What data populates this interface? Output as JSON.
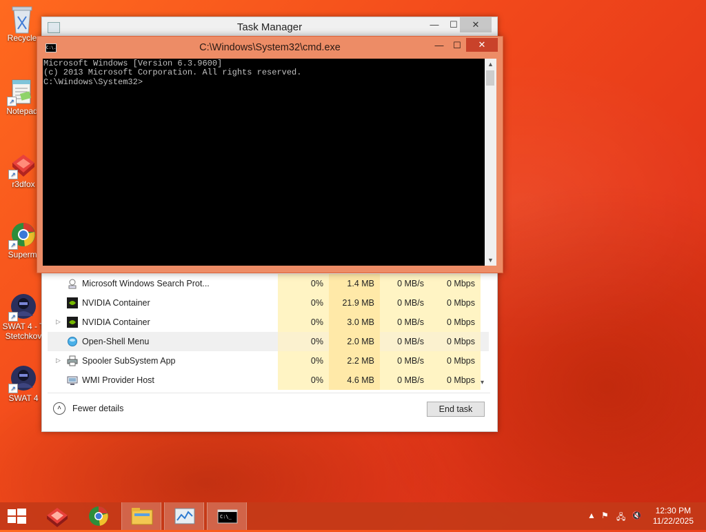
{
  "desktop": {
    "icons": [
      {
        "label": "Recycle",
        "icon": "recycle-bin-icon"
      },
      {
        "label": "Notepad",
        "icon": "notepad-icon"
      },
      {
        "label": "r3dfox",
        "icon": "r3dfox-icon"
      },
      {
        "label": "Supermi",
        "icon": "supermium-icon"
      },
      {
        "label": "SWAT 4 - T",
        "label2": "Stetchkov",
        "icon": "swat4-icon"
      },
      {
        "label": "SWAT 4",
        "icon": "swat4-icon"
      }
    ]
  },
  "task_manager": {
    "title": "Task Manager",
    "rows": [
      {
        "name": "Microsoft Windows Search Prot...",
        "cpu": "0%",
        "memory": "1.4 MB",
        "disk": "0 MB/s",
        "network": "0 Mbps",
        "expandable": false,
        "icon": "search-protocol-icon"
      },
      {
        "name": "NVIDIA Container",
        "cpu": "0%",
        "memory": "21.9 MB",
        "disk": "0 MB/s",
        "network": "0 Mbps",
        "expandable": false,
        "icon": "nvidia-icon"
      },
      {
        "name": "NVIDIA Container",
        "cpu": "0%",
        "memory": "3.0 MB",
        "disk": "0 MB/s",
        "network": "0 Mbps",
        "expandable": true,
        "icon": "nvidia-icon"
      },
      {
        "name": "Open-Shell Menu",
        "cpu": "0%",
        "memory": "2.0 MB",
        "disk": "0 MB/s",
        "network": "0 Mbps",
        "expandable": false,
        "icon": "open-shell-icon",
        "selected": true
      },
      {
        "name": "Spooler SubSystem App",
        "cpu": "0%",
        "memory": "2.2 MB",
        "disk": "0 MB/s",
        "network": "0 Mbps",
        "expandable": true,
        "icon": "printer-icon"
      },
      {
        "name": "WMI Provider Host",
        "cpu": "0%",
        "memory": "4.6 MB",
        "disk": "0 MB/s",
        "network": "0 Mbps",
        "expandable": false,
        "icon": "wmi-icon"
      }
    ],
    "fewer_details": "Fewer details",
    "end_task": "End task"
  },
  "cmd": {
    "title": "C:\\Windows\\System32\\cmd.exe",
    "icon_text": "C:\\.",
    "lines": [
      "Microsoft Windows [Version 6.3.9600]",
      "(c) 2013 Microsoft Corporation. All rights reserved.",
      "",
      "C:\\Windows\\System32>"
    ]
  },
  "taskbar": {
    "buttons": [
      "start-icon",
      "r3dfox-icon",
      "supermium-icon",
      "file-explorer-icon",
      "task-manager-icon",
      "cmd-icon"
    ],
    "active": "cmd-icon",
    "time": "12:30 PM",
    "date": "11/22/2025"
  },
  "colors": {
    "cmd_titlebar": "#ed8c66",
    "cmd_close": "#c9422a",
    "taskbar": "#c43a18",
    "cpu_column": "#fff4c4",
    "memory_column": "#ffe9a8"
  }
}
